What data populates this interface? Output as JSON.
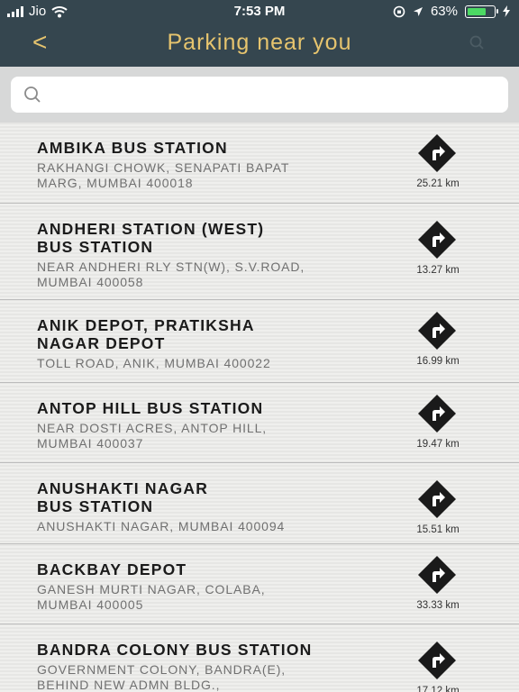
{
  "status": {
    "carrier": "Jio",
    "time": "7:53 PM",
    "battery": "63%"
  },
  "nav": {
    "back_label": "<",
    "title": "Parking near you"
  },
  "search": {
    "placeholder": ""
  },
  "stations": [
    {
      "name": [
        "AMBIKA BUS STATION"
      ],
      "address": [
        "RAKHANGI CHOWK, SENAPATI BAPAT",
        "MARG, MUMBAI 400018"
      ],
      "distance": "25.21 km"
    },
    {
      "name": [
        "ANDHERI STATION (WEST)",
        "BUS STATION"
      ],
      "address": [
        "NEAR ANDHERI RLY STN(W), S.V.ROAD,",
        "MUMBAI 400058"
      ],
      "distance": "13.27 km"
    },
    {
      "name": [
        "ANIK DEPOT, PRATIKSHA",
        "NAGAR DEPOT"
      ],
      "address": [
        "TOLL ROAD, ANIK, MUMBAI 400022"
      ],
      "distance": "16.99 km"
    },
    {
      "name": [
        "ANTOP HILL BUS STATION"
      ],
      "address": [
        "NEAR DOSTI ACRES, ANTOP HILL,",
        "MUMBAI 400037"
      ],
      "distance": "19.47 km"
    },
    {
      "name": [
        "ANUSHAKTI NAGAR",
        "BUS STATION"
      ],
      "address": [
        "ANUSHAKTI NAGAR, MUMBAI 400094"
      ],
      "distance": "15.51 km"
    },
    {
      "name": [
        "BACKBAY DEPOT"
      ],
      "address": [
        "GANESH MURTI NAGAR, COLABA,",
        "MUMBAI 400005"
      ],
      "distance": "33.33 km"
    },
    {
      "name": [
        "BANDRA COLONY BUS STATION"
      ],
      "address": [
        "GOVERNMENT COLONY, BANDRA(E),",
        "BEHIND NEW ADMN BLDG.,"
      ],
      "distance": "17.12 km"
    }
  ]
}
